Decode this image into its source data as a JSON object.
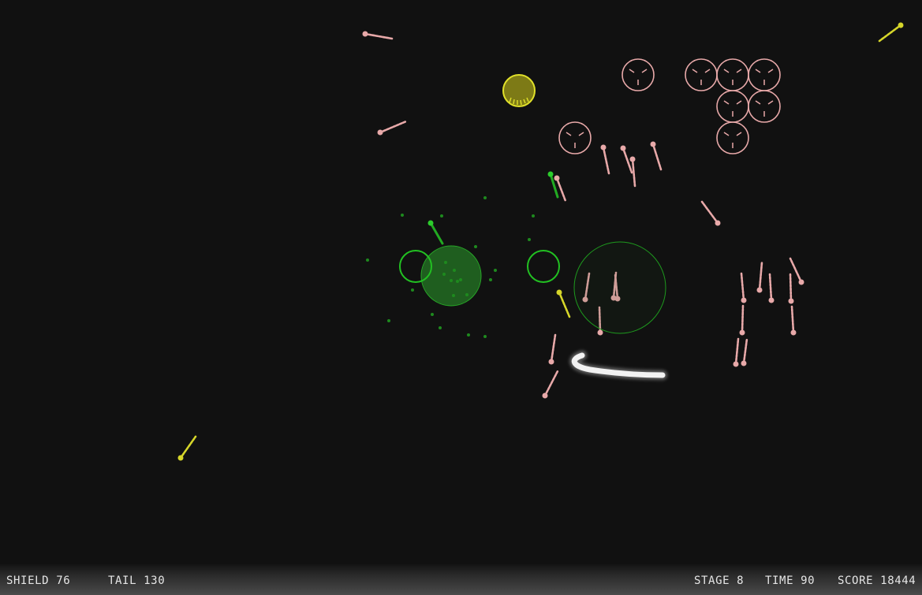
{
  "hud": {
    "shield": "SHIELD 76",
    "tail": "TAIL 130",
    "stage": "STAGE 8",
    "time": "TIME 90",
    "score": "SCORE 18444"
  },
  "colors": {
    "background": "#111111",
    "enemy_pink": "#e8a9a9",
    "ally_green": "#22bb22",
    "powerup_yellow": "#d6d62a",
    "player_white": "#f2f2f2"
  },
  "icons": {
    "enemy": "crosshair-circle-icon",
    "powerup": "yellow-orb-icon",
    "ring": "green-ring-icon",
    "player": "white-tail-icon"
  }
}
